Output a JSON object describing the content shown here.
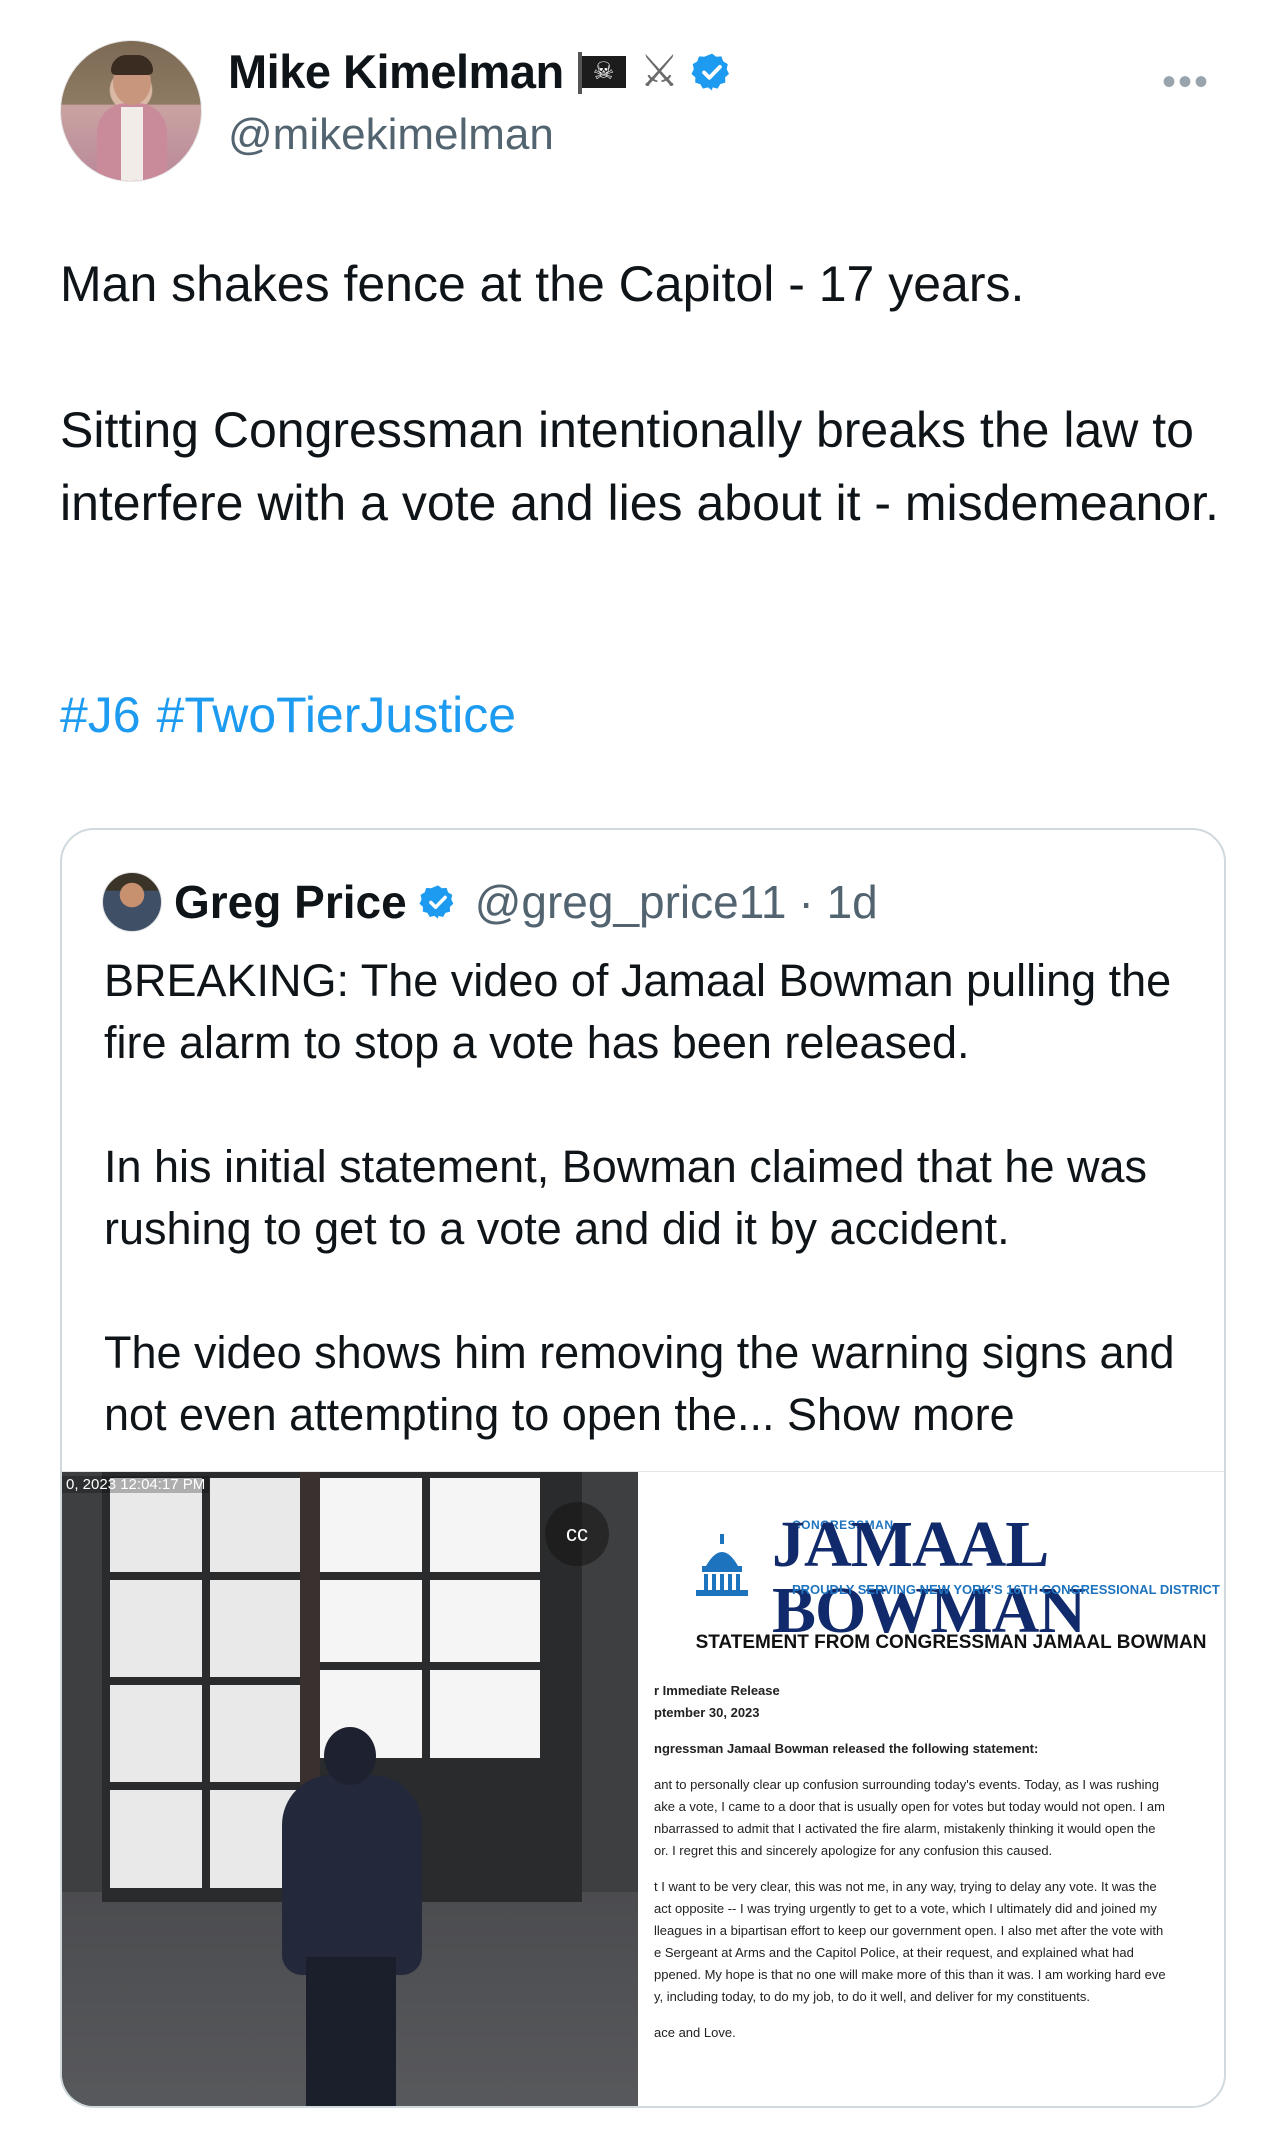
{
  "author": {
    "display_name": "Mike Kimelman",
    "handle": "@mikekimelman",
    "badge_emojis": [
      "pirate-flag",
      "crossed-swords"
    ],
    "more_label": "•••"
  },
  "tweet": {
    "line1": "Man shakes fence at the Capitol - 17 years.",
    "line2": "Sitting Congressman intentionally breaks the law to interfere with a vote and lies about it - misdemeanor.",
    "hashtags": [
      "#J6",
      "#TwoTierJustice"
    ]
  },
  "quote": {
    "display_name": "Greg Price",
    "handle": "@greg_price11",
    "time": "· 1d",
    "para1": "BREAKING: The video of Jamaal Bowman pulling the fire alarm to stop a vote has been released.",
    "para2": "In his initial statement, Bowman claimed that he was rushing to get to a vote and did it by accident.",
    "para3": "The video shows him removing the warning signs and not even attempting to open the...",
    "show_more": "Show more"
  },
  "media": {
    "video_timestamp": "0, 2023 12:04:17 PM",
    "cc_label": "cc",
    "statement": {
      "header_small": "CONGRESSMAN",
      "header_name": "JAMAAL BOWMAN",
      "header_sub": "PROUDLY SERVING NEW YORK'S 16TH CONGRESSIONAL DISTRICT",
      "title": "STATEMENT FROM CONGRESSMAN JAMAAL BOWMAN",
      "release_1": "r Immediate Release",
      "release_2": "ptember 30, 2023",
      "intro": "ngressman Jamaal Bowman released the following statement:",
      "p1_1": "ant to personally clear up confusion surrounding today's events. Today, as I was rushing",
      "p1_2": "ake a vote, I came to a door that is usually open for votes but today would not open. I am",
      "p1_3": "nbarrassed to admit that I activated the fire alarm, mistakenly thinking it would open the",
      "p1_4": "or. I regret this and sincerely apologize for any confusion this caused.",
      "p2_1": "t I want to be very clear, this was not me, in any way, trying to delay any vote. It was the",
      "p2_2": "act opposite -- I was trying urgently to get to a vote, which I ultimately did and joined my",
      "p2_3": "lleagues in a bipartisan effort to keep our government open. I also met after the vote with",
      "p2_4": "e Sergeant at Arms and the Capitol Police, at their request, and explained what had",
      "p2_5": "ppened. My hope is that no one will make more of this than it was. I am working hard eve",
      "p2_6": "y, including today, to do my job, to do it well, and deliver for my constituents.",
      "closing": "ace and Love."
    }
  },
  "colors": {
    "link": "#1d9bf0",
    "text": "#0f1419",
    "secondary": "#536471",
    "border": "#cfd9de",
    "verified": "#1d9bf0"
  }
}
